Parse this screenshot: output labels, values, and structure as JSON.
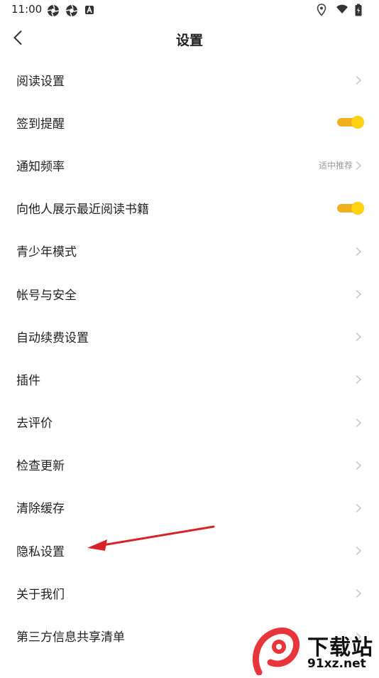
{
  "status_bar": {
    "time": "11:00",
    "left_icons": [
      "aperture-icon",
      "aperture-icon",
      "font-icon"
    ],
    "right_icons": [
      "location-icon",
      "wifi-icon",
      "battery-icon"
    ]
  },
  "header": {
    "title": "设置",
    "back_icon": "chevron-left-icon"
  },
  "settings": [
    {
      "label": "阅读设置",
      "control": "chevron"
    },
    {
      "label": "签到提醒",
      "control": "toggle",
      "on": true
    },
    {
      "label": "通知频率",
      "control": "chevron",
      "value": "适中推荐"
    },
    {
      "label": "向他人展示最近阅读书籍",
      "control": "toggle",
      "on": true
    },
    {
      "label": "青少年模式",
      "control": "chevron"
    },
    {
      "label": "帐号与安全",
      "control": "chevron"
    },
    {
      "label": "自动续费设置",
      "control": "chevron"
    },
    {
      "label": "插件",
      "control": "chevron"
    },
    {
      "label": "去评价",
      "control": "chevron"
    },
    {
      "label": "检查更新",
      "control": "chevron"
    },
    {
      "label": "清除缓存",
      "control": "chevron"
    },
    {
      "label": "隐私设置",
      "control": "chevron"
    },
    {
      "label": "关于我们",
      "control": "chevron"
    },
    {
      "label": "第三方信息共享清单",
      "control": "chevron"
    }
  ],
  "colors": {
    "toggle_track": "#f2b01e",
    "toggle_knob": "#ffd40f",
    "annotation_arrow": "#d6232a",
    "chevron": "#c4c4c4"
  },
  "watermark": {
    "logo_text": "9",
    "top_text": "下载站",
    "bottom_text": "91xz.net"
  }
}
